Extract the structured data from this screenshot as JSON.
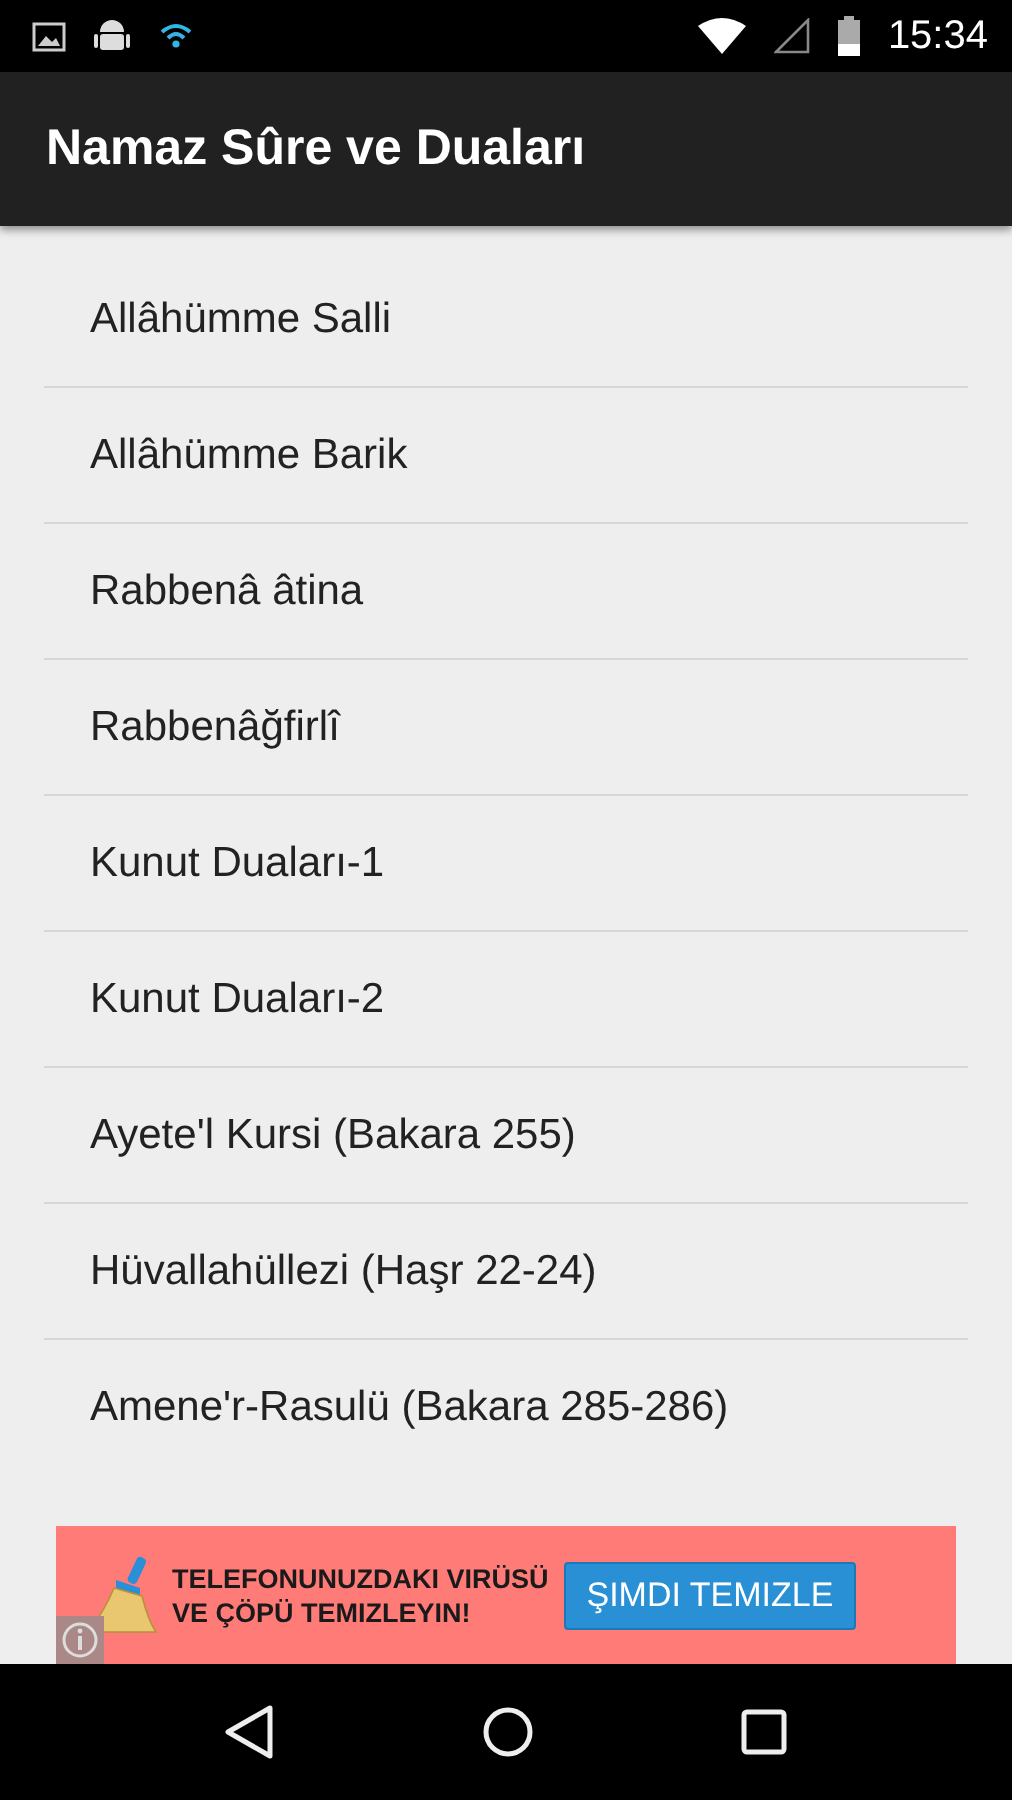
{
  "status_bar": {
    "time": "15:34"
  },
  "app_bar": {
    "title": "Namaz Sûre ve Duaları"
  },
  "list": {
    "items": [
      {
        "label": "Allâhümme Salli"
      },
      {
        "label": "Allâhümme Barik"
      },
      {
        "label": "Rabbenâ âtina"
      },
      {
        "label": "Rabbenâğfirlî"
      },
      {
        "label": "Kunut Duaları-1"
      },
      {
        "label": "Kunut Duaları-2"
      },
      {
        "label": "Ayete'l Kursi (Bakara 255)"
      },
      {
        "label": "Hüvallahüllezi (Haşr 22-24)"
      },
      {
        "label": "Amene'r-Rasulü (Bakara 285-286)"
      }
    ]
  },
  "ad_banner": {
    "lines": [
      "TELEFONUNUZDAKI VIRÜSÜ",
      "VE ÇÖPÜ TEMIZLEYIN!"
    ],
    "button": "ŞIMDI TEMIZLE"
  }
}
